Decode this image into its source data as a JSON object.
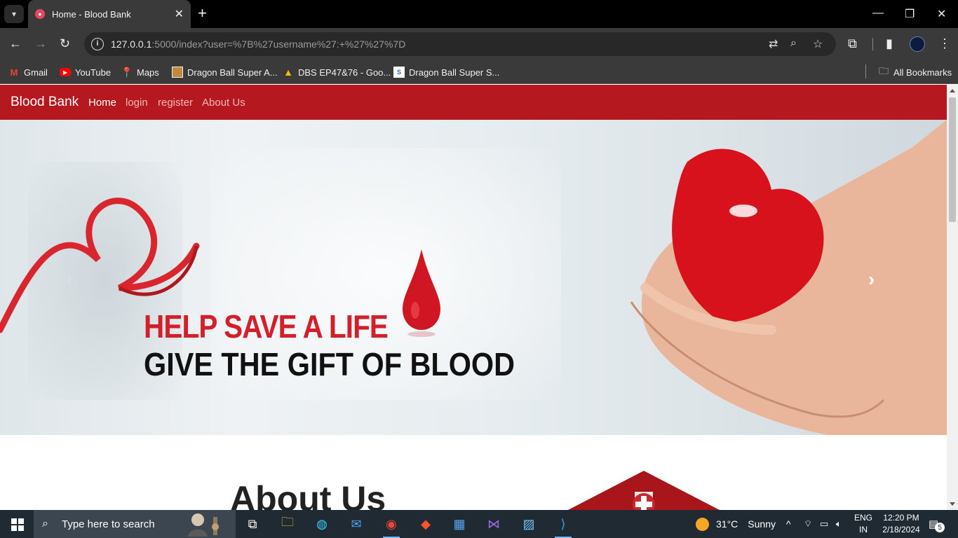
{
  "browser": {
    "tab_title": "Home - Blood Bank",
    "url_host": "127.0.0.1",
    "url_rest": ":5000/index?user=%7B%27username%27:+%27%27%7D",
    "bookmarks": [
      {
        "label": "Gmail",
        "icon": "gmail-icon"
      },
      {
        "label": "YouTube",
        "icon": "youtube-icon"
      },
      {
        "label": "Maps",
        "icon": "maps-icon"
      },
      {
        "label": "Dragon Ball Super A...",
        "icon": "image-favicon"
      },
      {
        "label": "DBS EP47&76 - Goo...",
        "icon": "google-drive-icon"
      },
      {
        "label": "Dragon Ball Super S...",
        "icon": "site-favicon"
      }
    ],
    "all_bookmarks": "All Bookmarks"
  },
  "site": {
    "brand": "Blood Bank",
    "nav": [
      "Home",
      "login",
      "register",
      "About Us"
    ],
    "active_nav": "Home",
    "accent": "#b5191f"
  },
  "hero": {
    "line1": "HELP SAVE A LIFE",
    "line2": "GIVE THE GIFT OF BLOOD"
  },
  "about": {
    "title": "About Us"
  },
  "taskbar": {
    "search_placeholder": "Type here to search",
    "weather_temp": "31°C",
    "weather_text": "Sunny",
    "lang_top": "ENG",
    "lang_bottom": "IN",
    "time": "12:20 PM",
    "date": "2/18/2024",
    "notifications": "5"
  }
}
